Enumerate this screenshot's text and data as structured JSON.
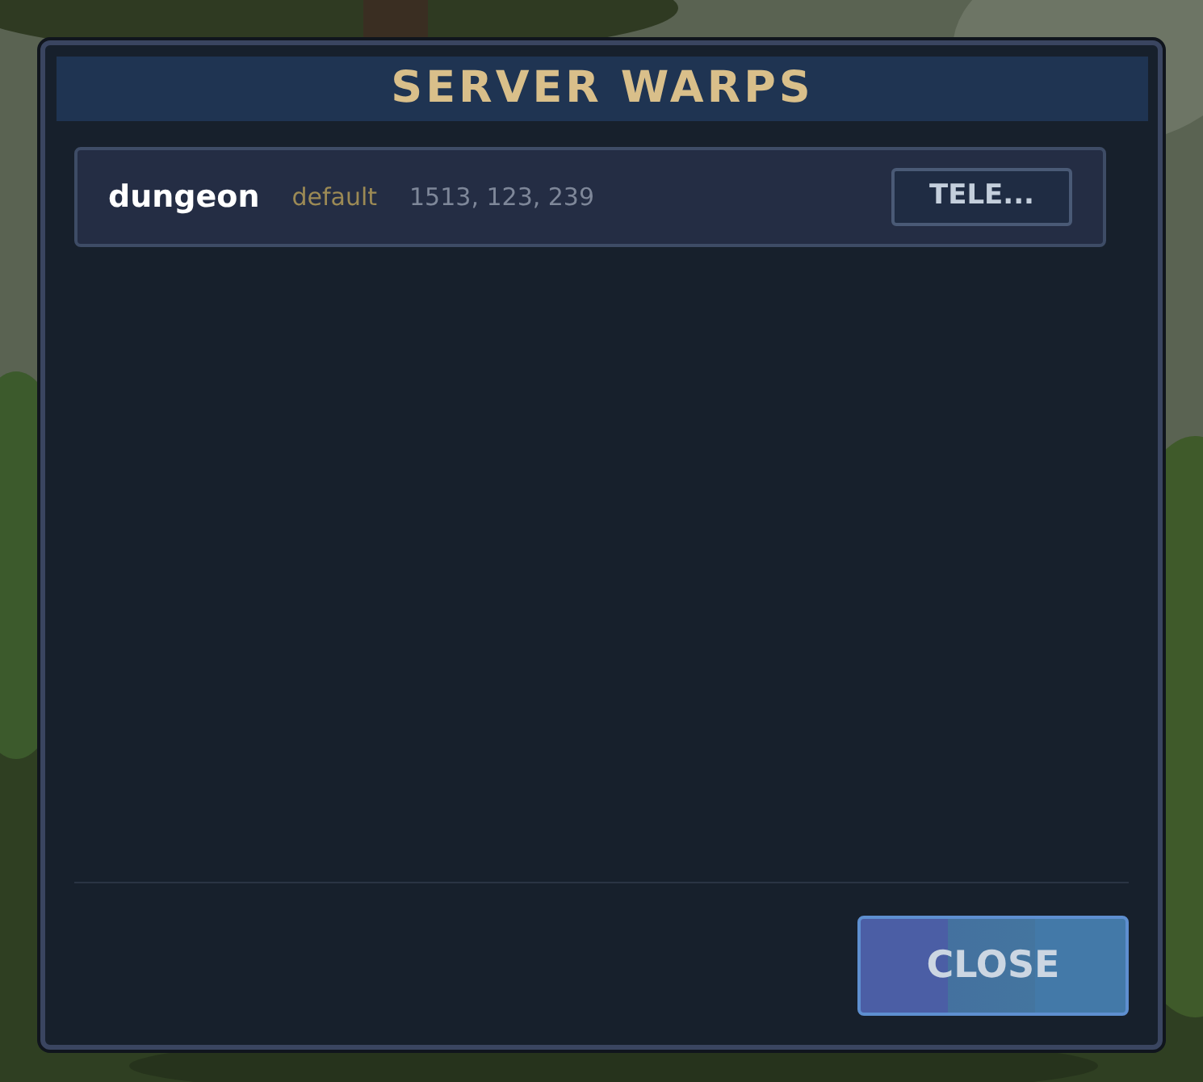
{
  "dialog": {
    "title": "SERVER WARPS"
  },
  "warps": [
    {
      "name": "dungeon",
      "category": "default",
      "coordinates": "1513, 123, 239",
      "button": "TELE..."
    }
  ],
  "buttons": [
    "CLOSE"
  ]
}
